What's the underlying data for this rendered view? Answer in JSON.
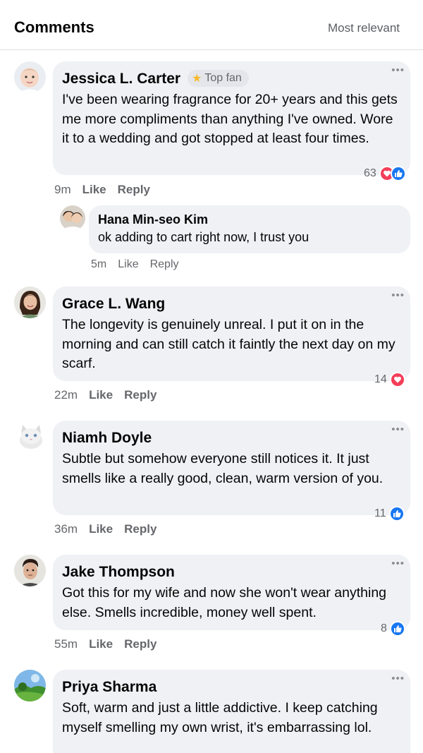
{
  "header": {
    "title": "Comments",
    "sort_label": "Most relevant"
  },
  "colors": {
    "like": "#1877f2",
    "love": "#f33e58",
    "bubble": "#eff1f5",
    "star": "#f7b928"
  },
  "comments": [
    {
      "name": "Jessica L. Carter",
      "badge": "Top fan",
      "text": "I've been wearing fragrance for 20+ years and this gets me more compliments than anything I've owned. Wore it to a wedding and got stopped at least four times.",
      "reaction_count": "63",
      "reactions": [
        "love-icon",
        "like-icon"
      ],
      "time": "9m",
      "like": "Like",
      "reply": "Reply",
      "replies": [
        {
          "name": "Hana Min-seo Kim",
          "text": "ok adding to cart right now, I trust you",
          "time": "5m",
          "like": "Like",
          "reply": "Reply"
        }
      ]
    },
    {
      "name": "Grace L. Wang",
      "text": "The longevity is genuinely unreal. I put it on in the morning and can still catch it faintly the next day on my scarf.",
      "reaction_count": "14",
      "reactions": [
        "love-icon"
      ],
      "time": "22m",
      "like": "Like",
      "reply": "Reply"
    },
    {
      "name": "Niamh Doyle",
      "text": "Subtle but somehow everyone still notices it. It just smells like a really good, clean, warm version of you.",
      "reaction_count": "11",
      "reactions": [
        "like-icon"
      ],
      "time": "36m",
      "like": "Like",
      "reply": "Reply"
    },
    {
      "name": "Jake Thompson",
      "text": "Got this for my wife and now she won't wear anything else. Smells incredible, money well spent.",
      "reaction_count": "8",
      "reactions": [
        "like-icon"
      ],
      "time": "55m",
      "like": "Like",
      "reply": "Reply"
    },
    {
      "name": "Priya Sharma",
      "text": "Soft, warm and just a little addictive. I keep catching myself smelling my own wrist, it's embarrassing lol."
    }
  ]
}
